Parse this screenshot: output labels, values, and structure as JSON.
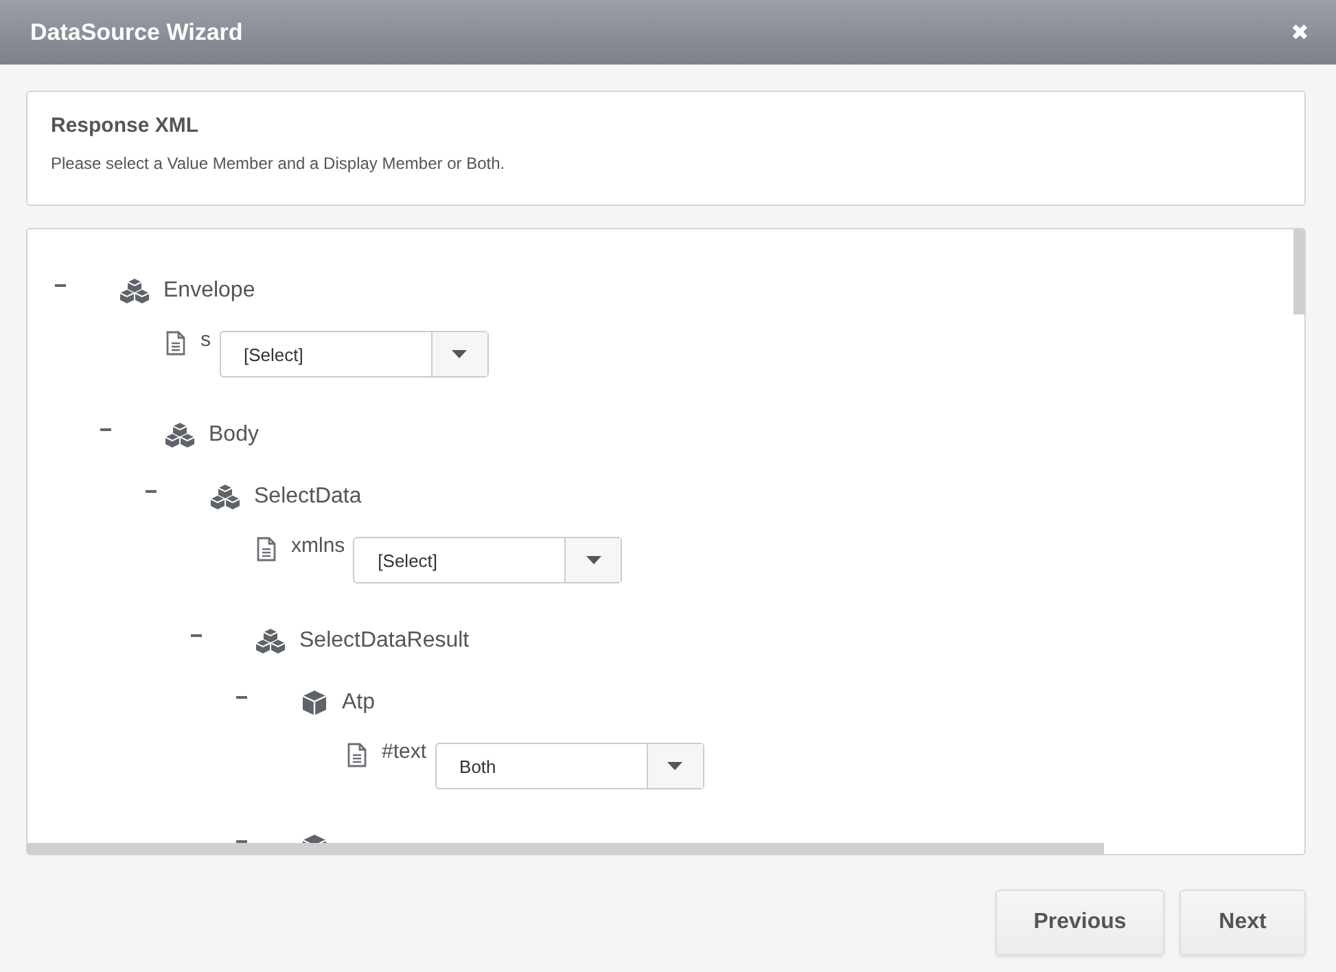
{
  "window": {
    "title": "DataSource Wizard",
    "close": "✖"
  },
  "header": {
    "title": "Response XML",
    "text": "Please select a Value Member and a Display Member or Both."
  },
  "tree": [
    {
      "kind": "group",
      "label": "Envelope",
      "expanded": true,
      "children": [
        {
          "kind": "attribute",
          "label": "s",
          "value": "[Select]"
        },
        {
          "kind": "group",
          "label": "Body",
          "expanded": true,
          "children": [
            {
              "kind": "group",
              "label": "SelectData",
              "expanded": true,
              "children": [
                {
                  "kind": "attribute",
                  "label": "xmlns",
                  "value": "[Select]"
                },
                {
                  "kind": "group",
                  "label": "SelectDataResult",
                  "expanded": true,
                  "children": [
                    {
                      "kind": "object",
                      "label": "Atp",
                      "expanded": true,
                      "children": [
                        {
                          "kind": "attribute",
                          "label": "#text",
                          "value": "Both"
                        }
                      ]
                    },
                    {
                      "kind": "object",
                      "expanded": true
                    }
                  ]
                }
              ]
            }
          ]
        }
      ]
    }
  ],
  "buttons": [
    "Previous",
    "Next"
  ]
}
